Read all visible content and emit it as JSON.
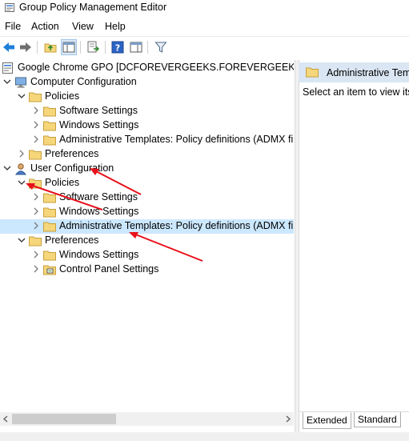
{
  "window": {
    "title": "Group Policy Management Editor"
  },
  "menu": [
    "File",
    "Action",
    "View",
    "Help"
  ],
  "toolbar": {
    "icons": [
      "back-icon",
      "forward-icon",
      "up-folder-icon",
      "show-hide-tree-icon",
      "export-list-icon",
      "help-icon",
      "properties-icon",
      "filter-icon"
    ]
  },
  "tree": {
    "items": [
      {
        "label": "Google Chrome GPO [DCFOREVERGEEKS.FOREVERGEEKS.COM] P",
        "icon": "gpo-icon"
      },
      {
        "label": "Computer Configuration",
        "icon": "computer-icon"
      },
      {
        "label": "Policies",
        "icon": "folder-icon"
      },
      {
        "label": "Software Settings",
        "icon": "folder-icon"
      },
      {
        "label": "Windows Settings",
        "icon": "folder-icon"
      },
      {
        "label": "Administrative Templates: Policy definitions (ADMX file",
        "icon": "folder-icon"
      },
      {
        "label": "Preferences",
        "icon": "folder-icon"
      },
      {
        "label": "User Configuration",
        "icon": "user-icon"
      },
      {
        "label": "Policies",
        "icon": "folder-icon"
      },
      {
        "label": "Software Settings",
        "icon": "folder-icon"
      },
      {
        "label": "Windows Settings",
        "icon": "folder-icon"
      },
      {
        "label": "Administrative Templates: Policy definitions (ADMX file",
        "icon": "folder-icon",
        "selected": true
      },
      {
        "label": "Preferences",
        "icon": "folder-icon"
      },
      {
        "label": "Windows Settings",
        "icon": "folder-icon"
      },
      {
        "label": "Control Panel Settings",
        "icon": "control-panel-icon"
      }
    ]
  },
  "right": {
    "header": "Administrative Tem",
    "text": "Select an item to view its"
  },
  "tabs": [
    "Extended",
    "Standard"
  ],
  "colors": {
    "selection": "#cce8ff",
    "header": "#dae6f3",
    "annotation": "#e8101a",
    "folder": "#f5d67a"
  }
}
